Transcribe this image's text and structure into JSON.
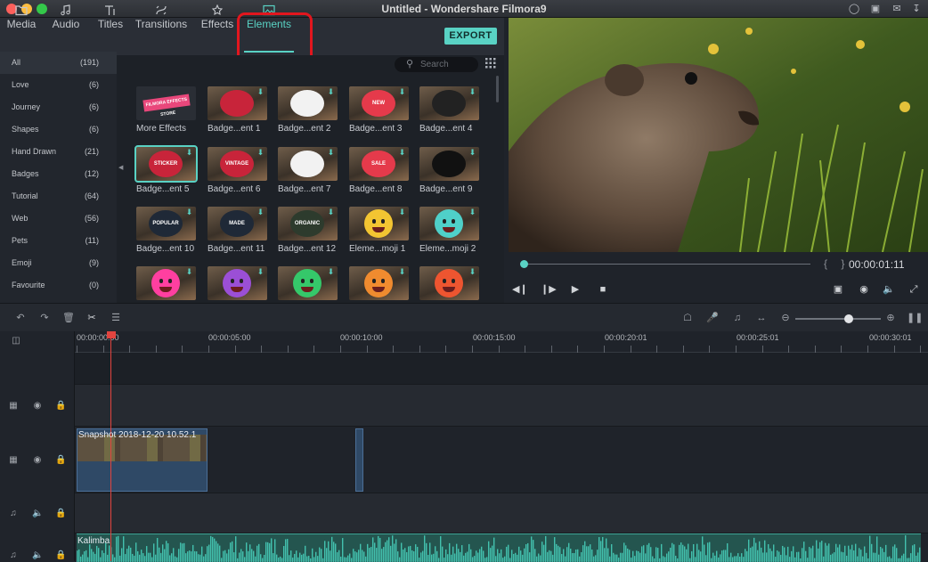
{
  "window": {
    "title": "Untitled - Wondershare Filmora9"
  },
  "tabs": [
    {
      "label": "Media",
      "icon": "folder-icon"
    },
    {
      "label": "Audio",
      "icon": "music-note-icon"
    },
    {
      "label": "Titles",
      "icon": "titles-icon"
    },
    {
      "label": "Transitions",
      "icon": "transitions-icon"
    },
    {
      "label": "Effects",
      "icon": "effects-icon"
    },
    {
      "label": "Elements",
      "icon": "image-icon",
      "active": true
    }
  ],
  "export_label": "EXPORT",
  "categories": [
    {
      "name": "All",
      "count": "(191)"
    },
    {
      "name": "Love",
      "count": "(6)"
    },
    {
      "name": "Journey",
      "count": "(6)"
    },
    {
      "name": "Shapes",
      "count": "(6)"
    },
    {
      "name": "Hand Drawn",
      "count": "(21)"
    },
    {
      "name": "Badges",
      "count": "(12)"
    },
    {
      "name": "Tutorial",
      "count": "(64)"
    },
    {
      "name": "Web",
      "count": "(56)"
    },
    {
      "name": "Pets",
      "count": "(11)"
    },
    {
      "name": "Emoji",
      "count": "(9)"
    },
    {
      "name": "Favourite",
      "count": "(0)"
    }
  ],
  "search": {
    "placeholder": "Search"
  },
  "elements": [
    {
      "caption": "More Effects",
      "art": "FILMORA EFFECTS STORE"
    },
    {
      "caption": "Badge...ent 1",
      "art": "badge"
    },
    {
      "caption": "Badge...ent 2",
      "art": "camera badge"
    },
    {
      "caption": "Badge...ent 3",
      "art": "NEW"
    },
    {
      "caption": "Badge...ent 4",
      "art": "badge"
    },
    {
      "caption": "Badge...ent 5",
      "art": "STICKER"
    },
    {
      "caption": "Badge...ent 6",
      "art": "VINTAGE"
    },
    {
      "caption": "Badge...ent 7",
      "art": "badge"
    },
    {
      "caption": "Badge...ent 8",
      "art": "SALE"
    },
    {
      "caption": "Badge...ent 9",
      "art": "badge"
    },
    {
      "caption": "Badge...ent 10",
      "art": "POPULAR"
    },
    {
      "caption": "Badge...ent 11",
      "art": "MADE FRESH"
    },
    {
      "caption": "Badge...ent 12",
      "art": "ORGANIC"
    },
    {
      "caption": "Eleme...moji 1",
      "art": "smile emoji"
    },
    {
      "caption": "Eleme...moji 2",
      "art": "laughing emoji"
    },
    {
      "caption": "",
      "art": "pink emoji"
    },
    {
      "caption": "",
      "art": "purple emoji"
    },
    {
      "caption": "",
      "art": "green emoji"
    },
    {
      "caption": "",
      "art": "orange emoji"
    },
    {
      "caption": "",
      "art": "red emoji"
    }
  ],
  "preview": {
    "timecode": "00:00:01:11",
    "brackets": "{ }",
    "progress": 0.02
  },
  "ruler": [
    "00:00:00:00",
    "00:00:05:00",
    "00:00:10:00",
    "00:00:15:00",
    "00:00:20:01",
    "00:00:25:01",
    "00:00:30:01"
  ],
  "timeline": {
    "video_clip": "Snapshot 2018-12-20 10.52.1",
    "audio_clip": "Kalimba",
    "zoom": 0.6
  },
  "colors": {
    "accent": "#59d2c4",
    "playhead": "#e2443f",
    "highlight": "#e2161e"
  }
}
